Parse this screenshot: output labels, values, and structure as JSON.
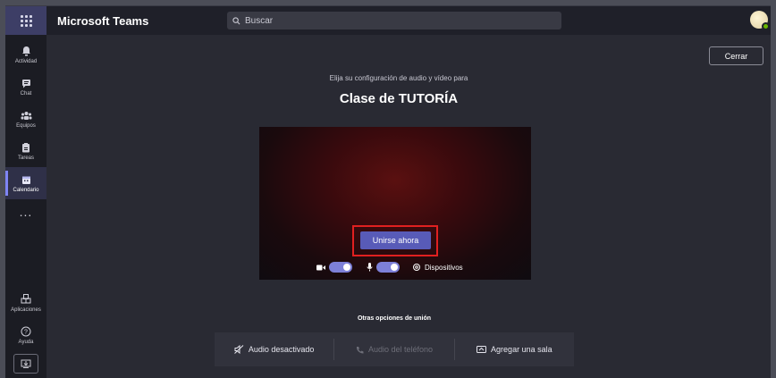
{
  "app": {
    "title": "Microsoft Teams"
  },
  "search": {
    "placeholder": "Buscar"
  },
  "sidebar": {
    "items": [
      {
        "label": "Actividad",
        "icon": "bell-icon"
      },
      {
        "label": "Chat",
        "icon": "chat-icon"
      },
      {
        "label": "Equipos",
        "icon": "teams-icon"
      },
      {
        "label": "Tareas",
        "icon": "tasks-icon"
      },
      {
        "label": "Calendario",
        "icon": "calendar-icon",
        "active": true
      }
    ],
    "more": "...",
    "bottom": [
      {
        "label": "Aplicaciones",
        "icon": "apps-icon"
      },
      {
        "label": "Ayuda",
        "icon": "help-icon"
      }
    ]
  },
  "header": {
    "close_label": "Cerrar"
  },
  "meeting": {
    "subtitle": "Elija su configuración de audio y vídeo para",
    "title": "Clase de TUTORÍA",
    "join_label": "Unirse ahora",
    "camera_on": true,
    "mic_on": true,
    "devices_label": "Dispositivos"
  },
  "other_options": {
    "heading": "Otras opciones de unión",
    "items": [
      {
        "label": "Audio desactivado",
        "icon": "speaker-off-icon",
        "enabled": true
      },
      {
        "label": "Audio del teléfono",
        "icon": "phone-icon",
        "enabled": false
      },
      {
        "label": "Agregar una sala",
        "icon": "room-icon",
        "enabled": true
      }
    ]
  },
  "colors": {
    "accent": "#585bb8",
    "highlight": "#e02020",
    "background": "#292a33"
  }
}
